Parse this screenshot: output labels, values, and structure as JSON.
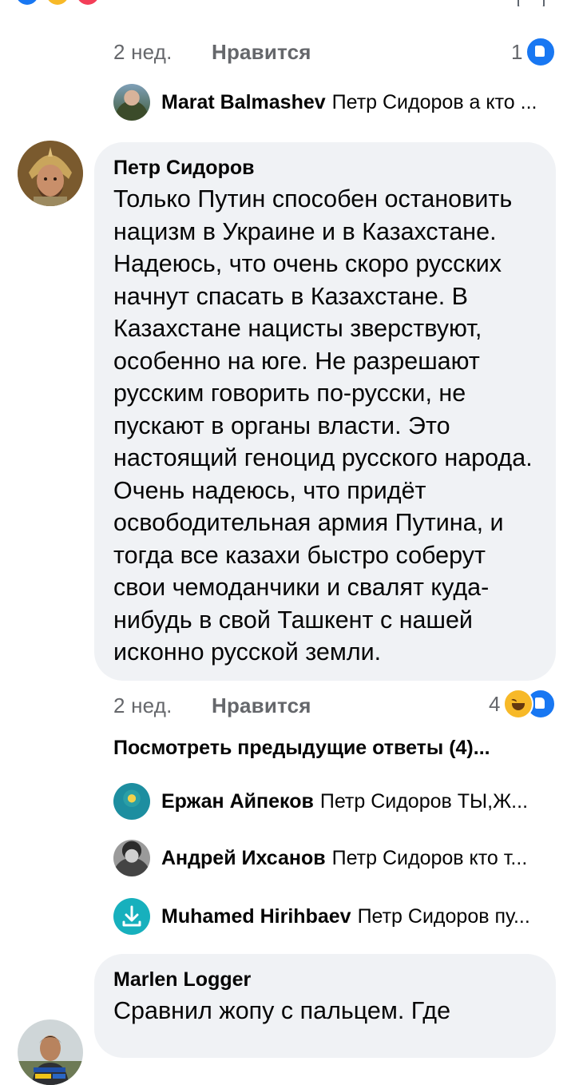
{
  "comments": [
    {
      "time": "2 нед.",
      "like_label": "Нравится",
      "reaction_count": "1",
      "reactions": [
        "like"
      ],
      "replies": [
        {
          "author": "Marat Balmashev",
          "preview": "Петр Сидоров а кто ..."
        }
      ]
    },
    {
      "author": "Петр Сидоров",
      "text": "Только Путин способен остановить нацизм в Украине и в Казахстане. Надеюсь, что очень скоро русских начнут спасать в Казахстане. В Казахстане нацисты зверствуют, особенно на юге. Не разрешают русским говорить по-русски, не пускают в органы власти. Это настоящий геноцид русского народа. Очень надеюсь, что придёт освободительная армия Путина, и тогда все казахи быстро соберут свои чемоданчики и свалят куда-нибудь в свой Ташкент с нашей исконно русской земли.",
      "time": "2 нед.",
      "like_label": "Нравится",
      "reaction_count": "4",
      "reactions": [
        "haha",
        "like"
      ],
      "view_previous": "Посмотреть предыдущие ответы (4)...",
      "replies": [
        {
          "author": "Ержан Айпеков",
          "preview": "Петр Сидоров ТЫ,Ж..."
        },
        {
          "author": "Андрей Ихсанов",
          "preview": "Петр Сидоров кто т..."
        },
        {
          "author": "Muhamed Hirihbaev",
          "preview": "Петр Сидоров пу..."
        }
      ]
    },
    {
      "author": "Marlen Logger",
      "text": "Сравнил жопу с пальцем. Где"
    }
  ],
  "colors": {
    "bubble_bg": "#f0f2f5",
    "meta_text": "#65676b",
    "like_blue": "#1877f2",
    "haha_yellow": "#f7b928"
  },
  "icons": [
    "like-reaction-icon",
    "haha-reaction-icon",
    "download-icon"
  ]
}
